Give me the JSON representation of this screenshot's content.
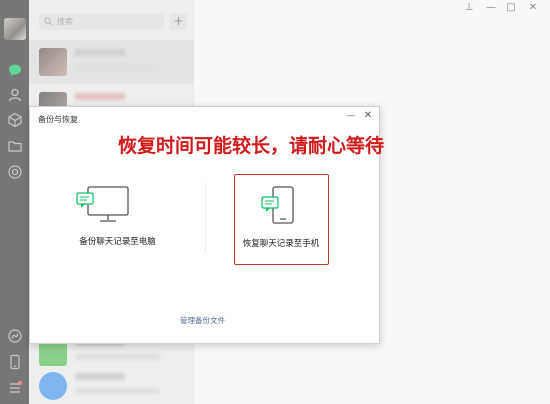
{
  "search": {
    "placeholder": "搜索",
    "icon": "search-icon"
  },
  "add_button": {
    "label": "+"
  },
  "sidebar": {
    "icons": [
      "chat-icon",
      "contacts-icon",
      "favorites-icon",
      "folder-icon",
      "moments-icon",
      "miniprogram-icon",
      "phone-icon",
      "menu-icon"
    ],
    "active_color": "#07c160"
  },
  "window": {
    "pin": "⊥",
    "minimize": "—",
    "maximize": "□",
    "close": "✕"
  },
  "dialog": {
    "title": "备份与恢复",
    "minimize": "—",
    "close": "✕",
    "notice": "恢复时间可能较长，请耐心等待",
    "notice_color": "#d11a1a",
    "backup_label": "备份聊天记录至电脑",
    "restore_label": "恢复聊天记录至手机",
    "manage_link": "管理备份文件",
    "highlight_color": "#c0392b"
  }
}
